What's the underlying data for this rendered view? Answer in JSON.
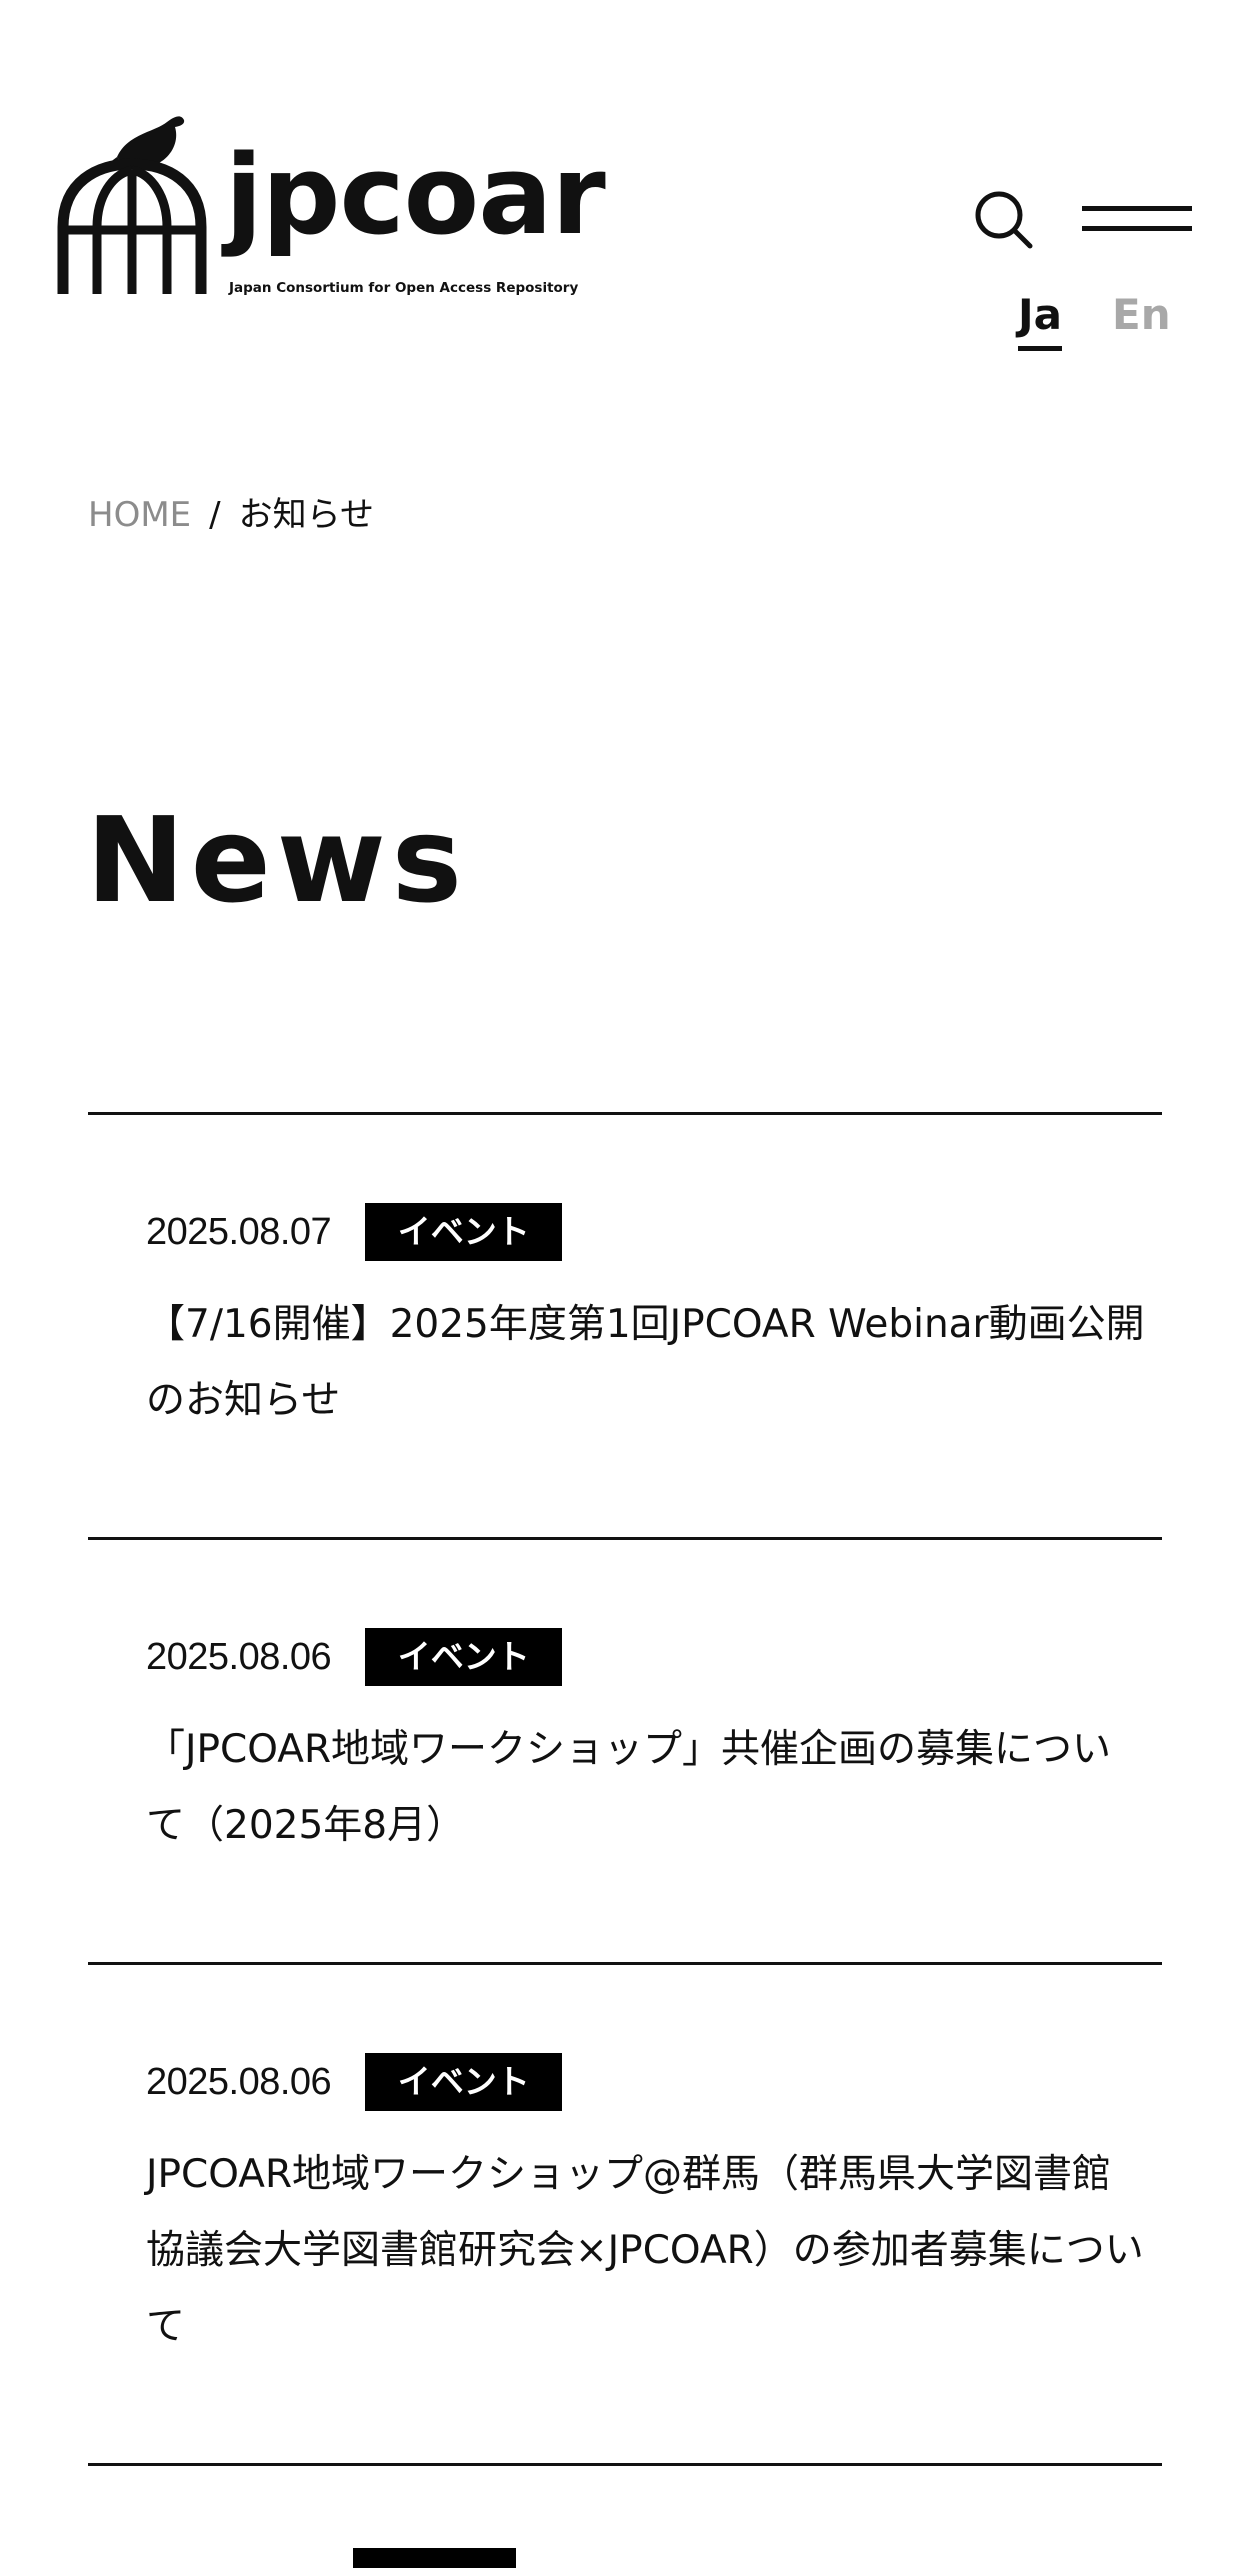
{
  "header": {
    "logo_word": "jpcoar",
    "logo_subtitle": "Japan Consortium for Open Access Repository",
    "search_icon": "search-icon",
    "menu_icon": "menu-icon",
    "lang_ja": "Ja",
    "lang_en": "En",
    "colors": {
      "text": "#111111",
      "inactive_lang": "#a8a8a8",
      "breadcrumb_home": "#8c8c8c",
      "tag_bg": "#000000",
      "tag_text": "#ffffff"
    }
  },
  "breadcrumb": {
    "home": "HOME",
    "separator": "/",
    "current": "お知らせ"
  },
  "page": {
    "title": "News"
  },
  "news": [
    {
      "date": "2025.08.07",
      "tag": "イベント",
      "title": "【7/16開催】2025年度第1回JPCOAR Webinar動画公開のお知らせ"
    },
    {
      "date": "2025.08.06",
      "tag": "イベント",
      "title": "「JPCOAR地域ワークショップ」共催企画の募集について（2025年8月）"
    },
    {
      "date": "2025.08.06",
      "tag": "イベント",
      "title": "JPCOAR地域ワークショップ@群馬（群馬県大学図書館協議会大学図書館研究会×JPCOAR）の参加者募集について"
    }
  ]
}
